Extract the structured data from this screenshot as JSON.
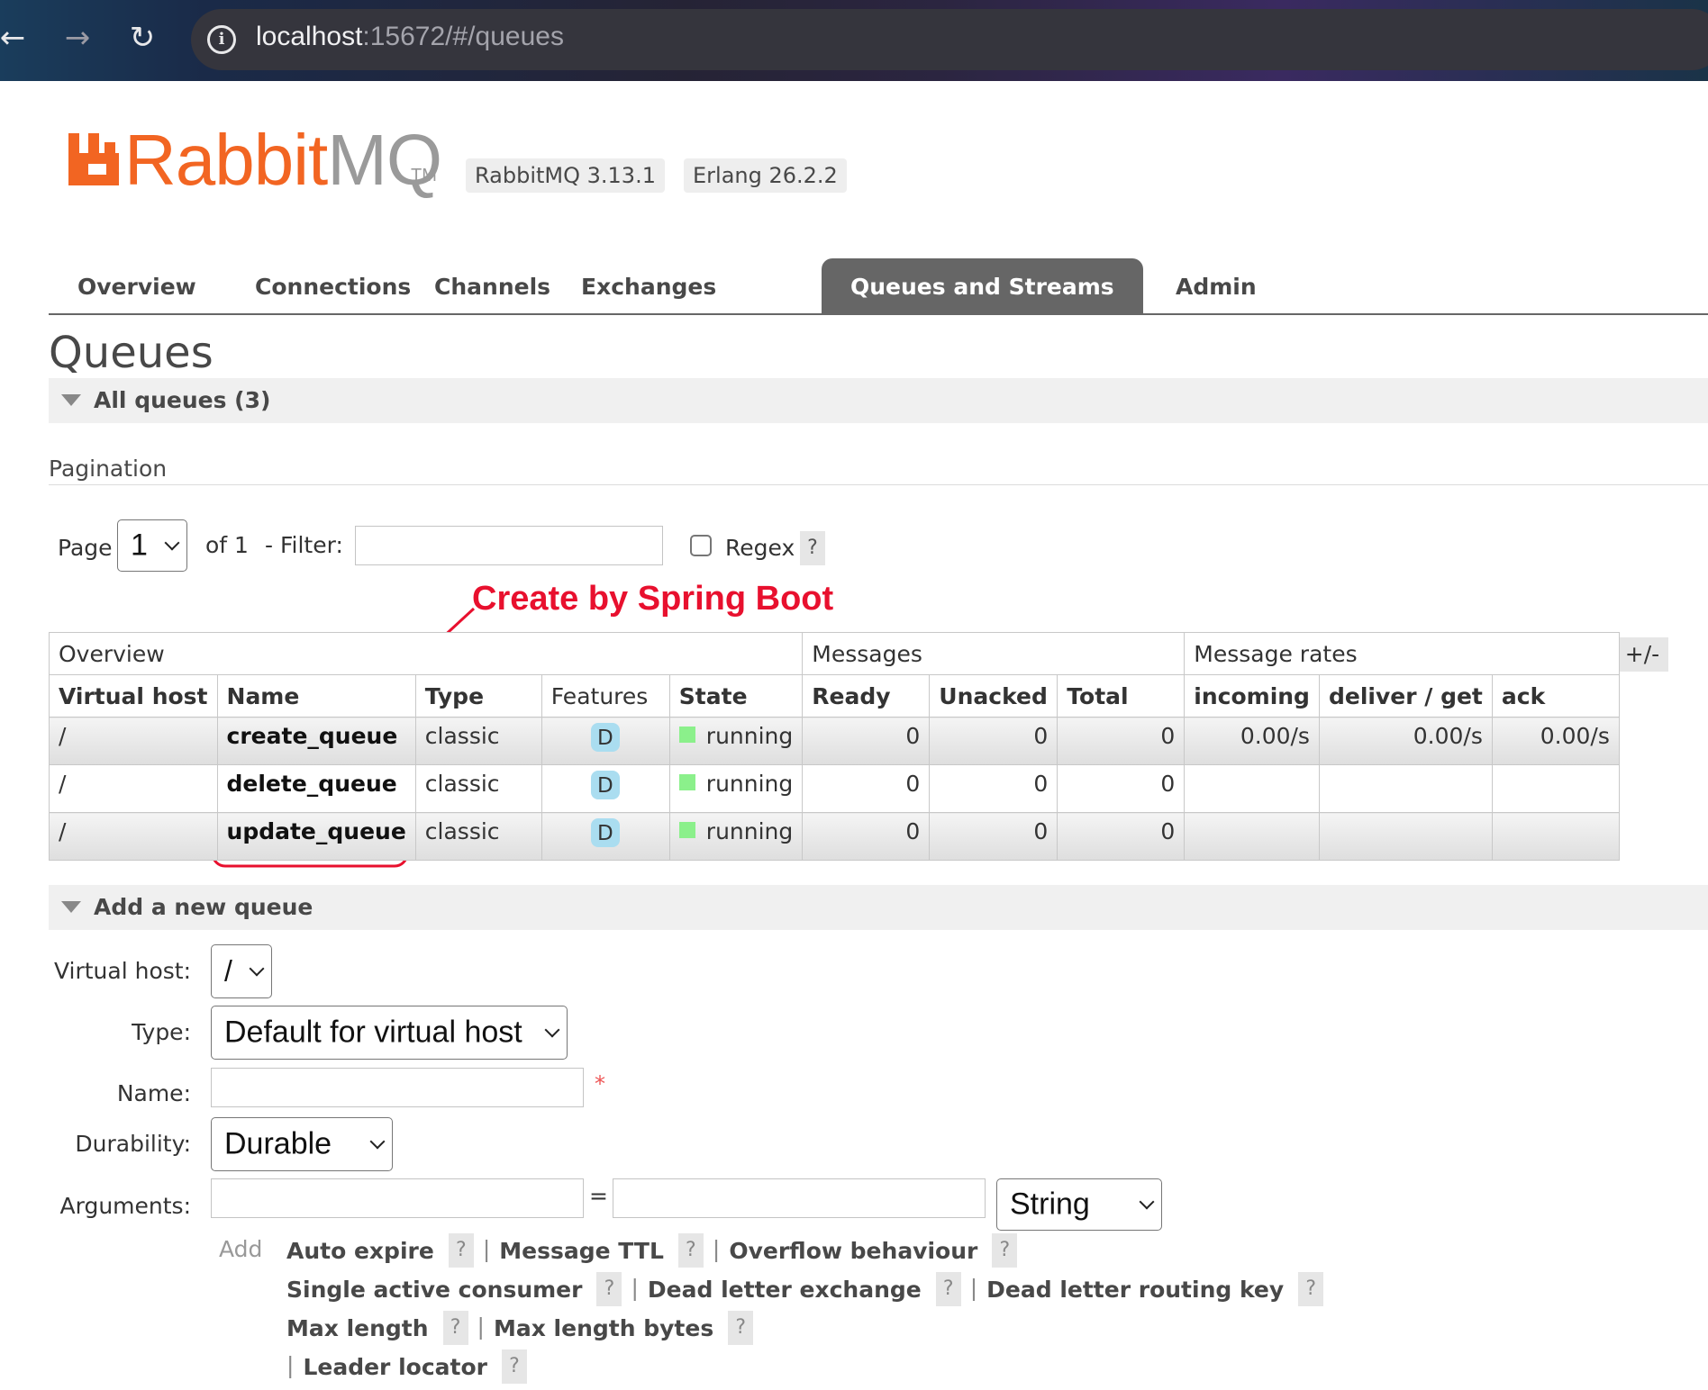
{
  "browser": {
    "url_host": "localhost",
    "url_path": ":15672/#/queues",
    "icons": [
      "back-arrow-icon",
      "forward-arrow-icon",
      "reload-icon",
      "info-icon"
    ]
  },
  "brand": {
    "logo_rabbit": "Rabbit",
    "logo_mq": "MQ",
    "logo_tm": "TM",
    "version": "RabbitMQ 3.13.1",
    "erlang": "Erlang 26.2.2",
    "accent_color": "#f26522"
  },
  "tabs": [
    {
      "label": "Overview",
      "active": false
    },
    {
      "label": "Connections",
      "active": false
    },
    {
      "label": "Channels",
      "active": false
    },
    {
      "label": "Exchanges",
      "active": false
    },
    {
      "label": "Queues and Streams",
      "active": true
    },
    {
      "label": "Admin",
      "active": false
    }
  ],
  "page": {
    "title": "Queues",
    "all_queues_label": "All queues (3)",
    "pagination_label": "Pagination"
  },
  "pagination": {
    "page_label": "Page",
    "page_value": "1",
    "of_label": "of 1",
    "filter_label": "- Filter:",
    "filter_value": "",
    "regex_label": "Regex",
    "regex_checked": false,
    "help": "?"
  },
  "annotation": {
    "text": "Create by Spring Boot",
    "color": "#e8102e"
  },
  "table": {
    "group_headers": [
      "Overview",
      "Messages",
      "Message rates"
    ],
    "plus_minus": "+/-",
    "columns": [
      "Virtual host",
      "Name",
      "Type",
      "Features",
      "State",
      "Ready",
      "Unacked",
      "Total",
      "incoming",
      "deliver / get",
      "ack"
    ],
    "rows": [
      {
        "vhost": "/",
        "name": "create_queue",
        "type": "classic",
        "feature": "D",
        "state": "running",
        "ready": "0",
        "unacked": "0",
        "total": "0",
        "incoming": "0.00/s",
        "deliver_get": "0.00/s",
        "ack": "0.00/s"
      },
      {
        "vhost": "/",
        "name": "delete_queue",
        "type": "classic",
        "feature": "D",
        "state": "running",
        "ready": "0",
        "unacked": "0",
        "total": "0",
        "incoming": "",
        "deliver_get": "",
        "ack": ""
      },
      {
        "vhost": "/",
        "name": "update_queue",
        "type": "classic",
        "feature": "D",
        "state": "running",
        "ready": "0",
        "unacked": "0",
        "total": "0",
        "incoming": "",
        "deliver_get": "",
        "ack": ""
      }
    ],
    "state_color": "#8bf08b",
    "feature_color": "#aaddf0"
  },
  "add_queue": {
    "section_label": "Add a new queue",
    "vhost_label": "Virtual host:",
    "vhost_value": "/",
    "type_label": "Type:",
    "type_value": "Default for virtual host",
    "name_label": "Name:",
    "name_value": "",
    "required_mark": "*",
    "durability_label": "Durability:",
    "durability_value": "Durable",
    "arguments_label": "Arguments:",
    "arg_key_value": "",
    "equals": "=",
    "arg_value_value": "",
    "arg_type_value": "String",
    "add_label": "Add",
    "arg_links": [
      [
        "Auto expire",
        "Message TTL",
        "Overflow behaviour"
      ],
      [
        "Single active consumer",
        "Dead letter exchange",
        "Dead letter routing key"
      ],
      [
        "Max length",
        "Max length bytes"
      ],
      [
        "Leader locator"
      ]
    ]
  }
}
